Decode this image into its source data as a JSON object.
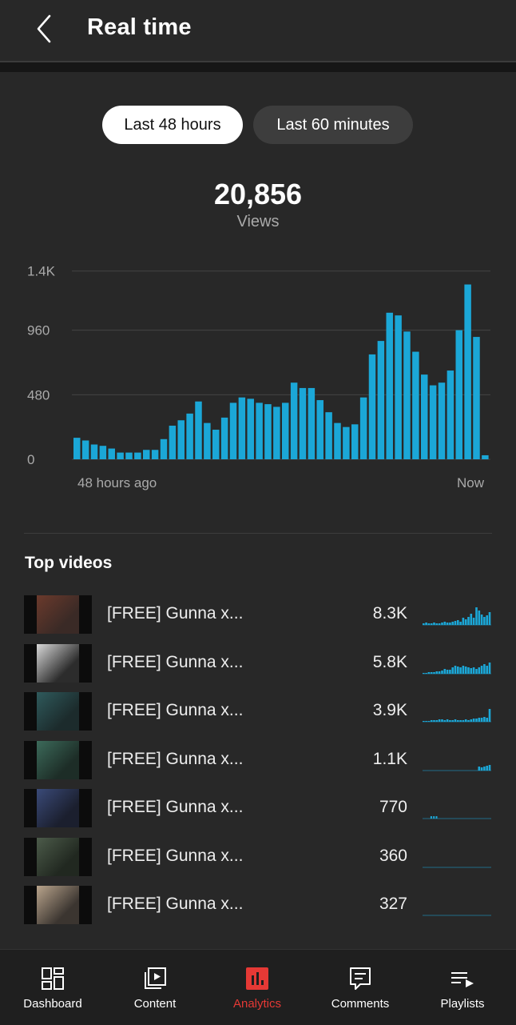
{
  "header": {
    "title": "Real time"
  },
  "toggle": {
    "options": [
      "Last 48 hours",
      "Last 60 minutes"
    ],
    "selected": "Last 48 hours"
  },
  "summary": {
    "total": "20,856",
    "metric": "Views"
  },
  "chart_data": {
    "type": "bar",
    "yticks": [
      "1.4K",
      "960",
      "480",
      "0"
    ],
    "ylim": [
      0,
      1440
    ],
    "x_start_label": "48 hours ago",
    "x_end_label": "Now",
    "values": [
      160,
      140,
      110,
      100,
      80,
      50,
      50,
      50,
      70,
      70,
      150,
      250,
      290,
      340,
      430,
      270,
      220,
      310,
      420,
      460,
      450,
      420,
      410,
      390,
      420,
      570,
      530,
      530,
      440,
      350,
      270,
      240,
      260,
      460,
      780,
      880,
      1090,
      1070,
      950,
      800,
      630,
      550,
      570,
      660,
      960,
      1300,
      910,
      30
    ],
    "color": "#1ba7d7"
  },
  "top_videos": {
    "title": "Top videos",
    "items": [
      {
        "title": "[FREE] Gunna x...",
        "views": "8.3K"
      },
      {
        "title": "[FREE] Gunna x...",
        "views": "5.8K"
      },
      {
        "title": "[FREE] Gunna x...",
        "views": "3.9K"
      },
      {
        "title": "[FREE] Gunna x...",
        "views": "1.1K"
      },
      {
        "title": "[FREE] Gunna x...",
        "views": "770"
      },
      {
        "title": "[FREE] Gunna x...",
        "views": "360"
      },
      {
        "title": "[FREE] Gunna x...",
        "views": "327"
      }
    ]
  },
  "tabs": [
    {
      "label": "Dashboard",
      "icon": "dashboard-icon"
    },
    {
      "label": "Content",
      "icon": "content-icon"
    },
    {
      "label": "Analytics",
      "icon": "analytics-icon"
    },
    {
      "label": "Comments",
      "icon": "comments-icon"
    },
    {
      "label": "Playlists",
      "icon": "playlists-icon"
    }
  ],
  "colors": {
    "accent": "#1ba7d7",
    "active_tab": "#e53935",
    "background": "#282828"
  }
}
